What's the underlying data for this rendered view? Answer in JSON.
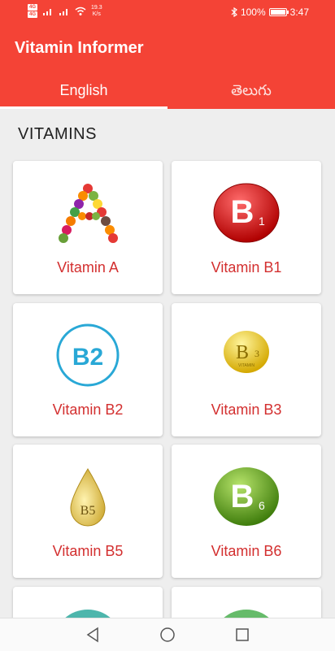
{
  "status_bar": {
    "sim1": "4G",
    "sim2": "4G",
    "net_speed": "19.3",
    "net_unit": "K/s",
    "battery_percent": "100%",
    "battery_level": 1.0,
    "time": "3:47"
  },
  "app": {
    "title": "Vitamin Informer",
    "accent_color": "#f44336",
    "tabs": [
      {
        "label": "English",
        "active": true
      },
      {
        "label": "తెలుగు",
        "active": false
      }
    ]
  },
  "section": {
    "title": "VITAMINS"
  },
  "vitamins": [
    {
      "label": "Vitamin A",
      "icon": "fruit-letter-a-icon"
    },
    {
      "label": "Vitamin B1",
      "icon": "red-b1-badge-icon",
      "badge": "B",
      "sub": "1"
    },
    {
      "label": "Vitamin B2",
      "icon": "blue-b2-circle-icon",
      "badge": "B2"
    },
    {
      "label": "Vitamin B3",
      "icon": "yellow-b3-capsule-icon",
      "badge": "B",
      "sub": "3",
      "caption": "VITAMIN"
    },
    {
      "label": "Vitamin B5",
      "icon": "gold-b5-drop-icon",
      "badge": "B5"
    },
    {
      "label": "Vitamin B6",
      "icon": "green-b6-badge-icon",
      "badge": "B",
      "sub": "6"
    }
  ],
  "nav": {
    "back": "back-icon",
    "home": "home-icon",
    "recents": "recents-icon"
  }
}
